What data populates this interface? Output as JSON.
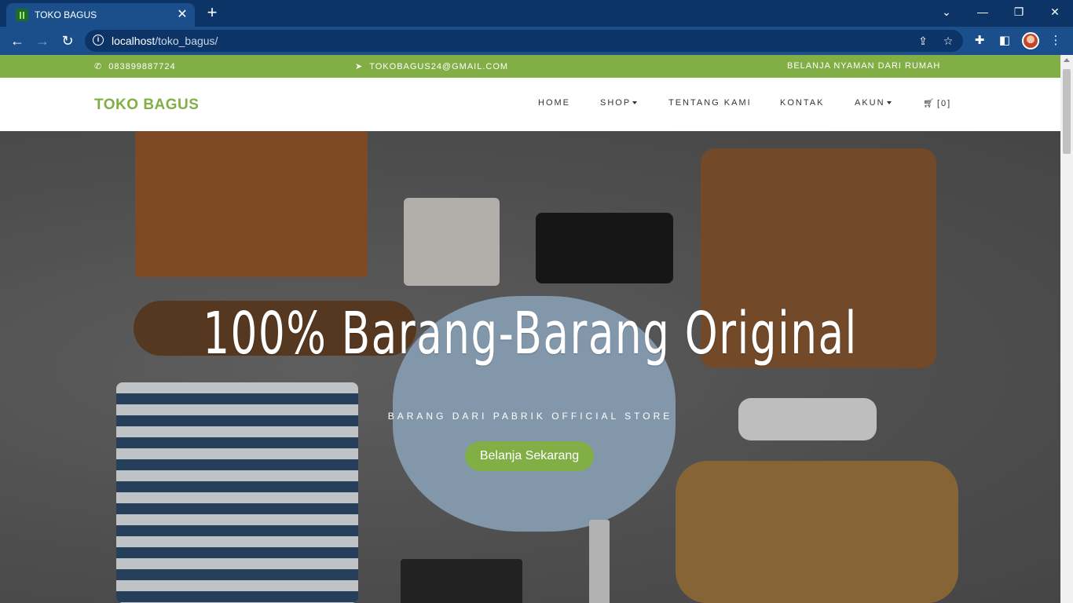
{
  "browser": {
    "tab_title": "TOKO BAGUS",
    "url_host": "localhost",
    "url_path": "/toko_bagus/"
  },
  "topbar": {
    "phone": "083899887724",
    "email": "TOKOBAGUS24@GMAIL.COM",
    "tagline": "BELANJA NYAMAN DARI RUMAH"
  },
  "navbar": {
    "brand": "TOKO BAGUS",
    "menu": [
      "HOME",
      "SHOP",
      "TENTANG KAMI",
      "KONTAK",
      "AKUN"
    ],
    "cart": "[0]"
  },
  "hero": {
    "title": "100% Barang-Barang Original",
    "subtitle": "BARANG DARI PABRIK OFFICIAL STORE",
    "button": "Belanja Sekarang"
  },
  "colors": {
    "brand_green": "#82ae46",
    "chrome_dark": "#0d3466",
    "chrome_bar": "#1b4f8c"
  },
  "icons": [
    "phone-icon",
    "paper-plane-icon",
    "cart-icon",
    "info-icon",
    "share-icon",
    "star-icon",
    "puzzle-icon",
    "sidebar-icon",
    "menu-dots-icon"
  ]
}
